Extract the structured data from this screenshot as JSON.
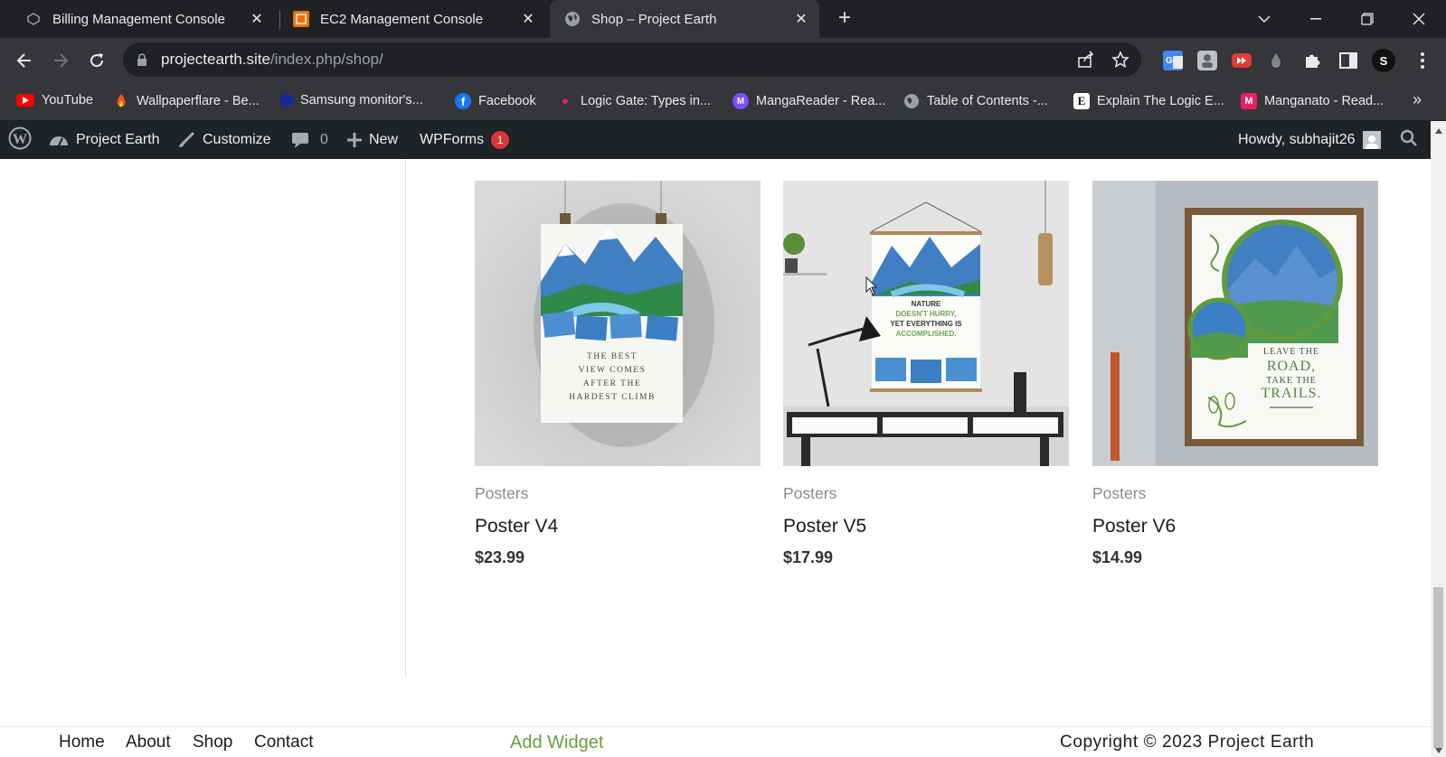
{
  "browser": {
    "tabs": [
      {
        "title": "Billing Management Console",
        "icon": "aws-billing-icon"
      },
      {
        "title": "EC2 Management Console",
        "icon": "aws-ec2-icon"
      },
      {
        "title": "Shop – Project Earth",
        "icon": "globe-icon",
        "active": true
      }
    ],
    "url_host": "projectearth.site",
    "url_path": "/index.php/shop/",
    "profile_initial": "S",
    "bookmarks": [
      {
        "label": "YouTube",
        "icon": "youtube-icon",
        "color": "#ff0000"
      },
      {
        "label": "Wallpaperflare - Be...",
        "icon": "flame-icon",
        "color": "#f4511e"
      },
      {
        "label": "Samsung monitor's...",
        "icon": "samsung-icon",
        "color": "#1428a0"
      },
      {
        "label": "Facebook",
        "icon": "facebook-icon",
        "color": "#1877f2"
      },
      {
        "label": "Logic Gate: Types in...",
        "icon": "dot-icon",
        "color": "#e91e63"
      },
      {
        "label": "MangaReader - Rea...",
        "icon": "mangareader-icon",
        "color": "#7c4dff"
      },
      {
        "label": "Table of Contents -...",
        "icon": "globe-icon",
        "color": "#9aa0a6"
      },
      {
        "label": "Explain The Logic E...",
        "icon": "e-icon",
        "color": "#222222"
      },
      {
        "label": "Manganato - Read...",
        "icon": "manganato-icon",
        "color": "#e91e63"
      }
    ],
    "more_bookmarks": "»"
  },
  "wpbar": {
    "site_name": "Project Earth",
    "customize": "Customize",
    "comments_count": "0",
    "new_label": "New",
    "wpforms_label": "WPForms",
    "wpforms_badge": "1",
    "howdy": "Howdy, subhajit26"
  },
  "products": [
    {
      "category": "Posters",
      "title": "Poster V4",
      "price": "$23.99",
      "poster_lines": [
        "THE BEST",
        "VIEW COMES",
        "AFTER THE",
        "HARDEST CLIMB"
      ]
    },
    {
      "category": "Posters",
      "title": "Poster V5",
      "price": "$17.99",
      "poster_lines": [
        "NATURE",
        "DOESN'T HURRY,",
        "YET EVERYTHING IS",
        "ACCOMPLISHED."
      ]
    },
    {
      "category": "Posters",
      "title": "Poster V6",
      "price": "$14.99",
      "poster_lines": [
        "LEAVE THE",
        "ROAD,",
        "TAKE THE",
        "TRAILS."
      ]
    }
  ],
  "footer": {
    "links": [
      "Home",
      "About",
      "Shop",
      "Contact"
    ],
    "add_widget": "Add Widget",
    "copyright": "Copyright © 2023 Project Earth"
  }
}
